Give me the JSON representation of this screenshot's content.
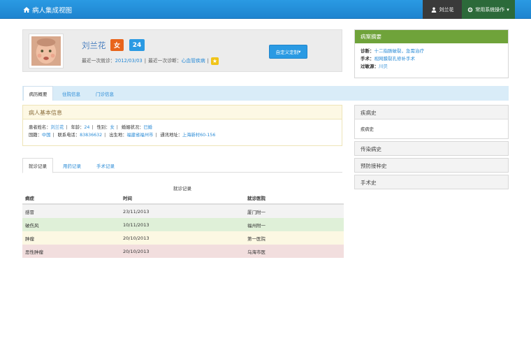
{
  "navbar": {
    "title": "病人集成视图",
    "user": "刘兰花",
    "ops": "常用系统操作",
    "home_icon": "home-icon",
    "user_icon": "user-icon",
    "ops_icon": "gear-icon"
  },
  "patient": {
    "name": "刘兰花",
    "sex": "女",
    "age": "24",
    "last_visit_label": "最近一次就诊：",
    "last_visit": "2012/03/03",
    "last_dx_label": "最近一次诊断：",
    "last_dx": "心血管疾病",
    "custom_button": "自定义定制"
  },
  "summary": {
    "title": "病案摘要",
    "dx_label": "诊断：",
    "dx": "十二指肠破裂，急需治疗",
    "surgery_label": "手术：",
    "surgery": "视网膜裂孔修补手术",
    "allergy_label": "过敏源：",
    "allergy": "川贝"
  },
  "tabs": [
    "病历概要",
    "住院信息",
    "门诊信息"
  ],
  "basic_info": {
    "title": "病人基本信息",
    "row1": [
      {
        "k": "患者姓名：",
        "v": "刘兰花"
      },
      {
        "k": "年龄：",
        "v": "24"
      },
      {
        "k": "性别：",
        "v": "女"
      },
      {
        "k": "婚姻状况：",
        "v": "已婚"
      }
    ],
    "row2": [
      {
        "k": "国籍：",
        "v": "中国"
      },
      {
        "k": "联系电话：",
        "v": "83836632"
      },
      {
        "k": "出生地：",
        "v": "福建省福州市"
      },
      {
        "k": "通讯地址：",
        "v": "上海新村60-156"
      }
    ]
  },
  "subtabs": [
    "就诊记录",
    "用药记录",
    "手术记录"
  ],
  "visits": {
    "caption": "就诊记录",
    "headers": [
      "病症",
      "时间",
      "就诊医院"
    ],
    "rows": [
      {
        "disease": "感冒",
        "date": "23/11/2013",
        "hospital": "厦门附一"
      },
      {
        "disease": "破伤风",
        "date": "10/11/2013",
        "hospital": "福州附一"
      },
      {
        "disease": "肿瘤",
        "date": "20/10/2013",
        "hospital": "第一医院"
      },
      {
        "disease": "恶性肿瘤",
        "date": "20/10/2013",
        "hospital": "乌海市医"
      }
    ]
  },
  "history": {
    "disease": {
      "title": "疾病史",
      "body": "疾病史"
    },
    "infectious": {
      "title": "传染病史"
    },
    "vaccine": {
      "title": "预防接种史"
    },
    "surgery": {
      "title": "手术史"
    }
  },
  "colors": {
    "nav": "#2a9ae3",
    "summary_head": "#6fa33a",
    "sex_badge": "#e8641b",
    "age_badge": "#2a9ae3"
  }
}
